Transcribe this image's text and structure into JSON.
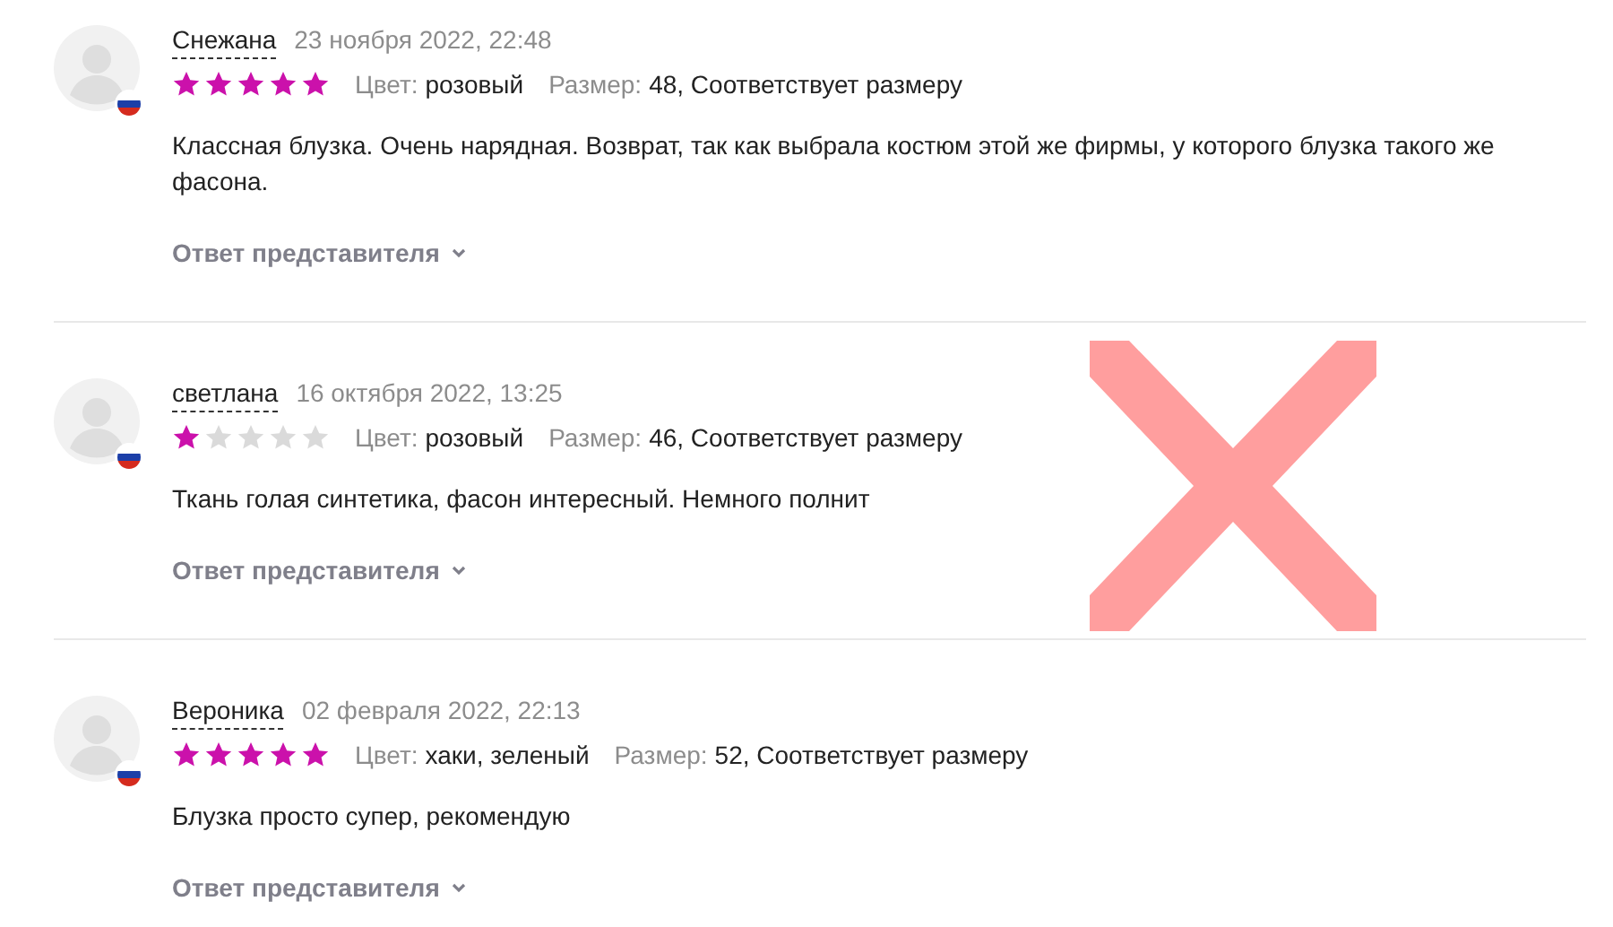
{
  "reviews": [
    {
      "name": "Снежана",
      "date": "23 ноября 2022, 22:48",
      "stars": 5,
      "color_label": "Цвет:",
      "color_value": "розовый",
      "size_label": "Размер:",
      "size_value": "48, Соответствует размеру",
      "text": "Классная блузка. Очень нарядная. Возврат, так как выбрала костюм этой же фирмы, у которого блузка такого же фасона.",
      "reply": "Ответ представителя"
    },
    {
      "name": "светлана",
      "date": "16 октября 2022, 13:25",
      "stars": 1,
      "color_label": "Цвет:",
      "color_value": "розовый",
      "size_label": "Размер:",
      "size_value": "46, Соответствует размеру",
      "text": "Ткань голая синтетика, фасон интересный. Немного полнит",
      "reply": "Ответ представителя"
    },
    {
      "name": "Вероника",
      "date": "02 февраля 2022, 22:13",
      "stars": 5,
      "color_label": "Цвет:",
      "color_value": "хаки, зеленый",
      "size_label": "Размер:",
      "size_value": "52, Соответствует размеру",
      "text": "Блузка просто супер, рекомендую",
      "reply": "Ответ представителя"
    }
  ]
}
